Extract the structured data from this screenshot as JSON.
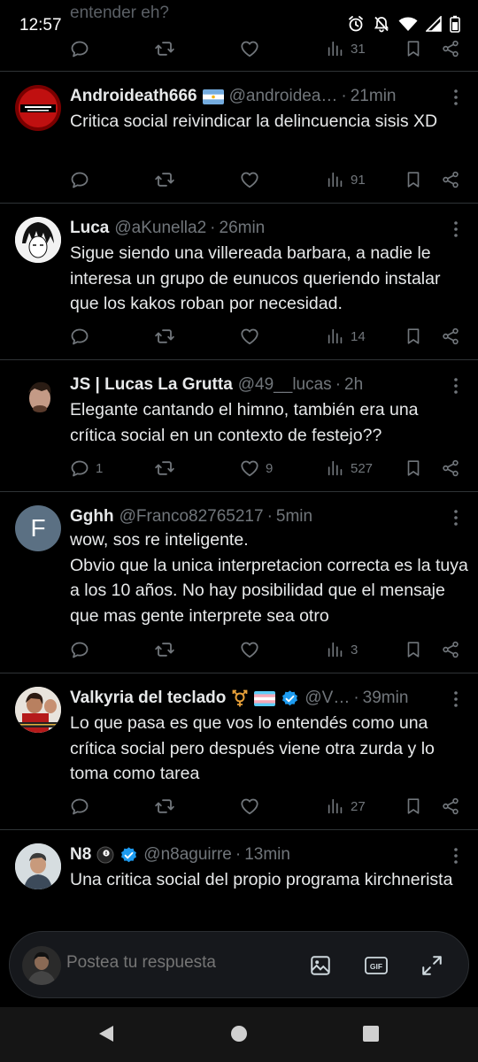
{
  "status": {
    "time": "12:57"
  },
  "top_post": {
    "cut_text": "entender eh?",
    "views": "31"
  },
  "posts": [
    {
      "name": "Androideath666",
      "handle": "@androidea…",
      "time": "21min",
      "text": "Critica social reivindicar la delincuencia sisis XD",
      "replies": "",
      "reposts": "",
      "likes": "",
      "views": "91",
      "avatar_text": "ANDROIDEATH"
    },
    {
      "name": "Luca",
      "handle": "@aKunella2",
      "time": "26min",
      "text": "Sigue siendo una villereada barbara, a nadie le interesa un grupo de eunucos queriendo instalar que los kakos roban por necesidad.",
      "replies": "",
      "reposts": "",
      "likes": "",
      "views": "14"
    },
    {
      "name": "JS | Lucas La Grutta",
      "handle": "@49__lucas",
      "time": "2h",
      "text": "Elegante cantando el himno, también era una crítica social en un contexto de festejo??",
      "replies": "1",
      "reposts": "",
      "likes": "9",
      "views": "527"
    },
    {
      "name": "Gghh",
      "handle": "@Franco82765217",
      "time": "5min",
      "text": "wow, sos re inteligente.\nObvio que la unica interpretacion correcta es la tuya a los 10 años. No hay posibilidad que el mensaje que mas gente interprete sea otro",
      "replies": "",
      "reposts": "",
      "likes": "",
      "views": "3",
      "avatar_letter": "F"
    },
    {
      "name": "Valkyria del teclado",
      "handle": "@V…",
      "time": "39min",
      "text": "Lo que pasa es que vos lo entendés como una crítica social pero después viene otra zurda y lo toma como tarea",
      "replies": "",
      "reposts": "",
      "likes": "",
      "views": "27"
    },
    {
      "name": "N8",
      "handle": "@n8aguirre",
      "time": "13min",
      "text": "Una critica social del propio programa kirchnerista"
    }
  ],
  "composer": {
    "placeholder": "Postea tu respuesta"
  },
  "colors": {
    "background": "#000000",
    "muted": "#71767b",
    "verified": "#1d9bf0",
    "divider": "#2f3336"
  }
}
